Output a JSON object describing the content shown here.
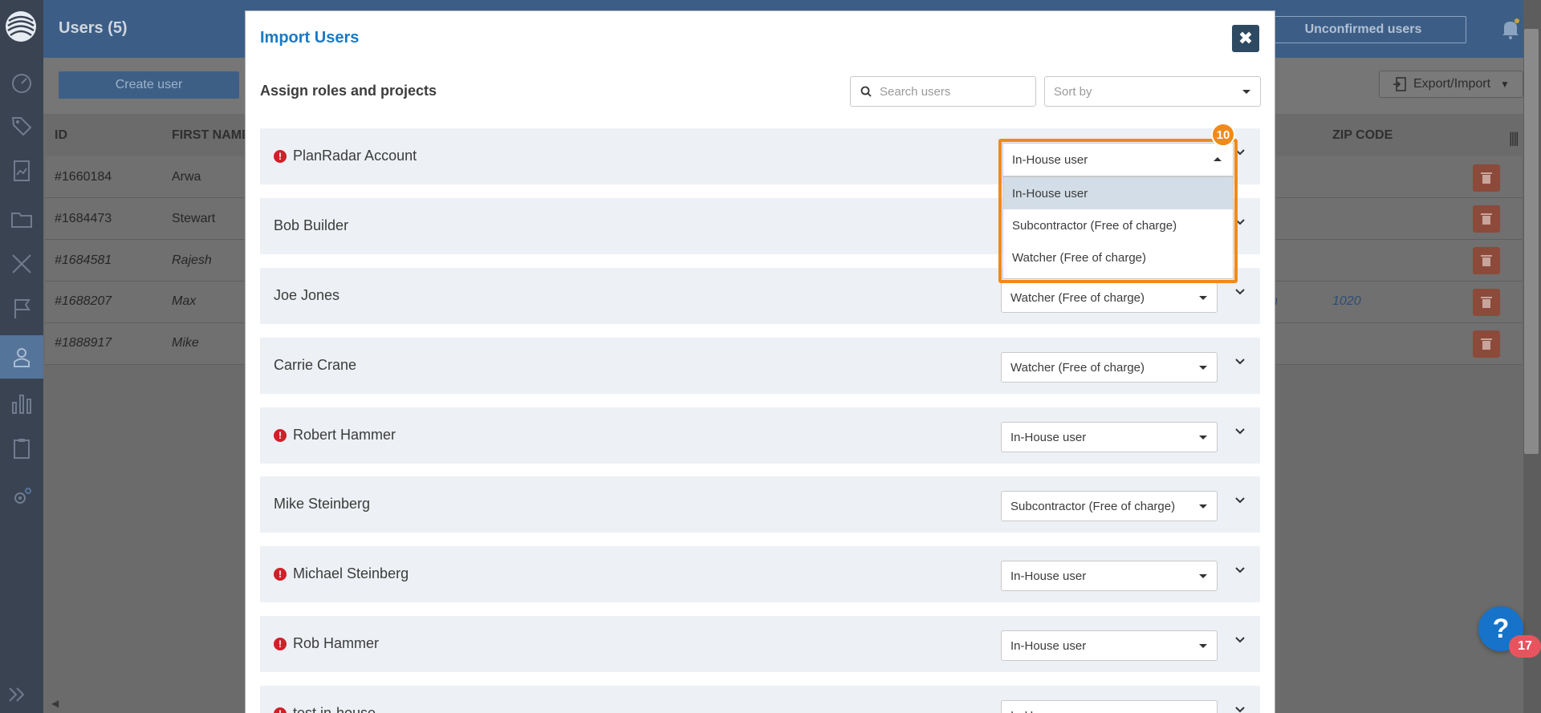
{
  "background": {
    "page_title": "Users (5)",
    "unconfirmed_label": "Unconfirmed users",
    "create_user_label": "Create user",
    "export_import_label": "Export/Import",
    "columns": {
      "id": "ID",
      "first_name": "FIRST NAME",
      "zip_code": "ZIP CODE"
    },
    "rows": [
      {
        "id": "#1660184",
        "first_name": "Arwa",
        "zip": "",
        "city": ""
      },
      {
        "id": "#1684473",
        "first_name": "Stewart",
        "zip": "",
        "city": ""
      },
      {
        "id": "#1684581",
        "first_name": "Rajesh",
        "zip": "",
        "city": ""
      },
      {
        "id": "#1688207",
        "first_name": "Max",
        "zip": "1020",
        "city": "n"
      },
      {
        "id": "#1888917",
        "first_name": "Mike",
        "zip": "",
        "city": ""
      }
    ],
    "help_badge_count": "17"
  },
  "modal": {
    "title": "Import Users",
    "close_label": "✖",
    "subtitle": "Assign roles and projects",
    "search_placeholder": "Search users",
    "sort_placeholder": "Sort by",
    "step_badge": "10",
    "dropdown": {
      "current": "In-House user",
      "options": [
        "In-House user",
        "Subcontractor (Free of charge)",
        "Watcher (Free of charge)"
      ],
      "selected_index": 0
    },
    "users": [
      {
        "name": "PlanRadar Account",
        "warning": true,
        "role": "In-House user"
      },
      {
        "name": "Bob Builder",
        "warning": false,
        "role": ""
      },
      {
        "name": "Joe Jones",
        "warning": false,
        "role": "Watcher (Free of charge)"
      },
      {
        "name": "Carrie Crane",
        "warning": false,
        "role": "Watcher (Free of charge)"
      },
      {
        "name": "Robert Hammer",
        "warning": true,
        "role": "In-House user"
      },
      {
        "name": "Mike Steinberg",
        "warning": false,
        "role": "Subcontractor (Free of charge)"
      },
      {
        "name": "Michael Steinberg",
        "warning": true,
        "role": "In-House user"
      },
      {
        "name": "Rob Hammer",
        "warning": true,
        "role": "In-House user"
      },
      {
        "name": "test in-house",
        "warning": true,
        "role": "In-House user"
      }
    ]
  },
  "colors": {
    "accent": "#1a7ac4",
    "highlight": "#f08a1a",
    "warning": "#d0202a",
    "sidebar": "#3a4352"
  }
}
